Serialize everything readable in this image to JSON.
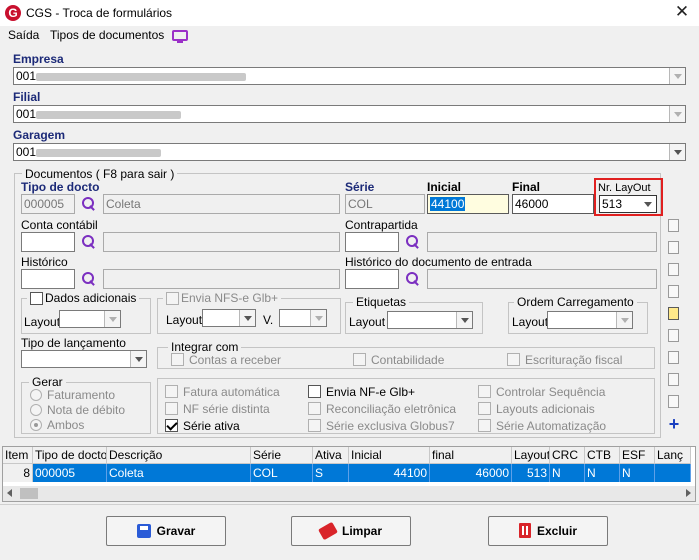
{
  "window": {
    "title": "CGS - Troca de formulários",
    "close": "✕"
  },
  "menu": {
    "items": [
      "Saída",
      "Tipos de documentos"
    ],
    "icon": "monitor-icon"
  },
  "empresa": {
    "label": "Empresa",
    "value": "001"
  },
  "filial": {
    "label": "Filial",
    "value": "001"
  },
  "garagem": {
    "label": "Garagem",
    "value": "001"
  },
  "documentos": {
    "group_title": "Documentos ( F8 para sair )",
    "tipo_docto": {
      "label": "Tipo de docto",
      "code": "000005",
      "desc": "Coleta"
    },
    "serie": {
      "label": "Série",
      "value": "COL"
    },
    "inicial": {
      "label": "Inicial",
      "value": "44100"
    },
    "final": {
      "label": "Final",
      "value": "46000"
    },
    "layout": {
      "label": "Nr. LayOut",
      "value": "513"
    },
    "conta_contabil": {
      "label": "Conta contábil"
    },
    "contrapartida": {
      "label": "Contrapartida"
    },
    "historico": {
      "label": "Histórico"
    },
    "historico_entrada": {
      "label": "Histórico do documento de entrada"
    },
    "dados_adicionais": {
      "label": "Dados adicionais",
      "layout_label": "Layout"
    },
    "envia_nfse": {
      "label": "Envia NFS-e Glb+",
      "layout_label": "Layout",
      "v_label": "V."
    },
    "etiquetas": {
      "label": "Etiquetas",
      "layout_label": "Layout"
    },
    "ordem_carregamento": {
      "label": "Ordem Carregamento",
      "layout_label": "Layout"
    },
    "tipo_lancamento": {
      "label": "Tipo de lançamento"
    },
    "integrar_com": {
      "label": "Integrar com",
      "options": [
        "Contas a receber",
        "Contabilidade",
        "Escrituração fiscal"
      ]
    },
    "gerar": {
      "label": "Gerar",
      "options": [
        "Faturamento",
        "Nota de débito",
        "Ambos"
      ],
      "selected": 2
    },
    "checks": {
      "fatura_automatica": "Fatura automática",
      "nf_serie_distinta": "NF série distinta",
      "serie_ativa": "Série ativa",
      "envia_nfe": "Envia NF-e Glb+",
      "reconciliacao": "Reconciliação eletrônica",
      "serie_exclusiva": "Série exclusiva Globus7",
      "controlar_sequencia": "Controlar Sequência",
      "layouts_adicionais": "Layouts adicionais",
      "serie_automatizacao": "Série Automatização"
    }
  },
  "grid": {
    "columns": [
      "Item",
      "Tipo de docto",
      "Descrição",
      "Série",
      "Ativa",
      "Inicial",
      "final",
      "Layout",
      "CRC",
      "CTB",
      "ESF",
      "Lanç"
    ],
    "rows": [
      {
        "item": "8",
        "tipo": "000005",
        "descricao": "Coleta",
        "serie": "COL",
        "ativa": "S",
        "inicial": "44100",
        "final": "46000",
        "layout": "513",
        "crc": "N",
        "ctb": "N",
        "esf": "N",
        "lanc": ""
      }
    ]
  },
  "buttons": {
    "gravar": "Gravar",
    "limpar": "Limpar",
    "excluir": "Excluir"
  },
  "colors": {
    "label_blue": "#1c2a78",
    "accent": "#0078d7",
    "highlight_box": "#e02020"
  }
}
